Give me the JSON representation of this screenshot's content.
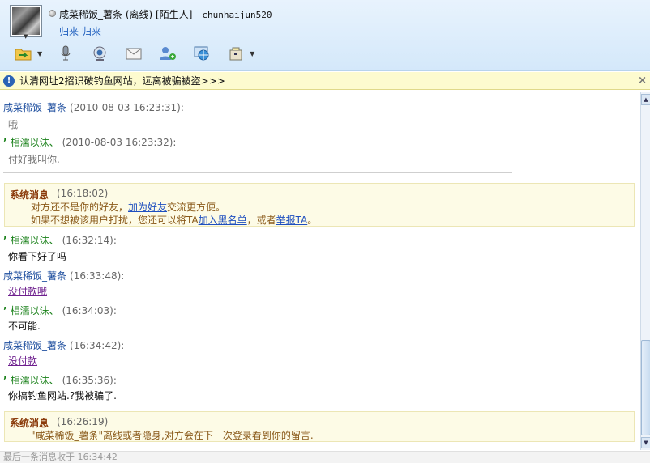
{
  "header": {
    "contact_name": "咸菜稀饭_薯条",
    "status": "(离线)",
    "tag_open": "[",
    "tag": "陌生人",
    "tag_close": "]",
    "separator": " - ",
    "qq_id": "chunhaijun520",
    "signature": "归来 归来"
  },
  "toolbar": {
    "icons": [
      "transfer-file-icon",
      "voice-icon",
      "video-icon",
      "mail-icon",
      "add-friend-icon",
      "web-icon",
      "app-icon"
    ]
  },
  "notice": {
    "icon": "!",
    "text": "认清网址2招识破钓鱼网站，远离被骗被盗>>>",
    "close": "×"
  },
  "messages": [
    {
      "sender": "咸菜稀饭_薯条",
      "time": "(2010-08-03 16:23:31):",
      "text": "哦"
    },
    {
      "sender": "相濡以沫、",
      "time": "(2010-08-03 16:23:32):",
      "text": "付好我叫你."
    },
    {
      "sender": "相濡以沫、",
      "time": "(16:32:14):",
      "text": "你看下好了吗"
    },
    {
      "sender": "咸菜稀饭_薯条",
      "time": "(16:33:48):",
      "text": "没付款哦"
    },
    {
      "sender": "相濡以沫、",
      "time": "(16:34:03):",
      "text": "不可能."
    },
    {
      "sender": "咸菜稀饭_薯条",
      "time": "(16:34:42):",
      "text": "没付款"
    },
    {
      "sender": "相濡以沫、",
      "time": "(16:35:36):",
      "text": "你搞钓鱼网站.?我被骗了."
    }
  ],
  "system1": {
    "title": "系统消息",
    "time": "(16:18:02)",
    "line1_a": "对方还不是你的好友，",
    "line1_link": "加为好友",
    "line1_b": "交流更方便。",
    "line2_a": "如果不想被该用户打扰，您还可以将TA",
    "line2_link1": "加入黑名单",
    "line2_b": "，或者",
    "line2_link2": "举报TA",
    "line2_c": "。"
  },
  "system2": {
    "title": "系统消息",
    "time": "(16:26:19)",
    "line": "\"咸菜稀饭_薯条\"离线或者隐身,对方会在下一次登录看到你的留言."
  },
  "statusbar": {
    "text": "最后一条消息收于 16:34:42"
  }
}
